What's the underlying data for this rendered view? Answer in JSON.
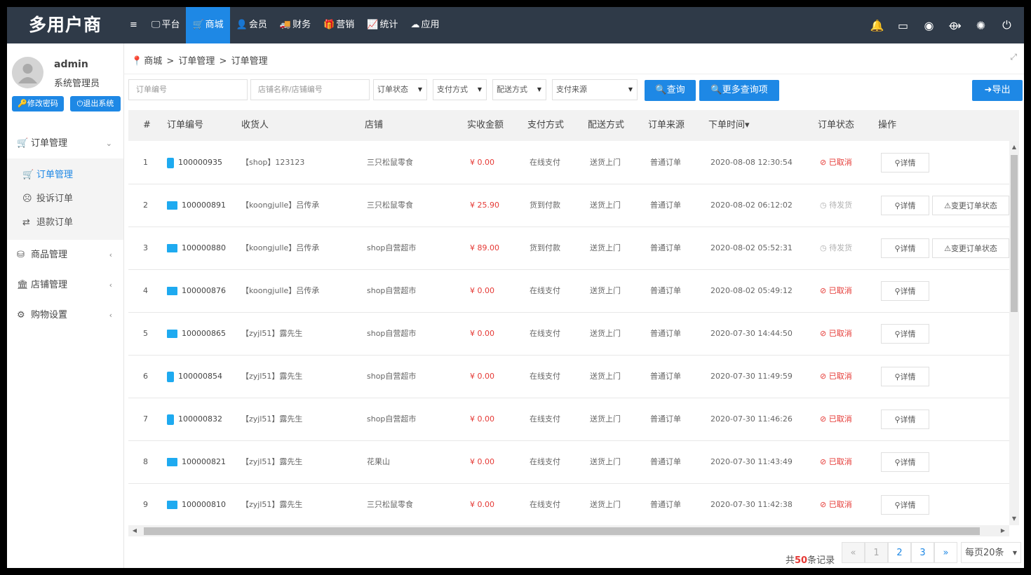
{
  "app": {
    "logo": "多用户商"
  },
  "nav": [
    {
      "icon": "≡",
      "label": "",
      "active": false
    },
    {
      "icon": "🖵",
      "label": "平台",
      "active": false
    },
    {
      "icon": "🛒",
      "label": "商城",
      "active": true
    },
    {
      "icon": "👤",
      "label": "会员",
      "active": false
    },
    {
      "icon": "🚚",
      "label": "财务",
      "active": false
    },
    {
      "icon": "🎁",
      "label": "营销",
      "active": false
    },
    {
      "icon": "📈",
      "label": "统计",
      "active": false
    },
    {
      "icon": "☁",
      "label": "应用",
      "active": false
    }
  ],
  "user": {
    "name": "admin",
    "role": "系统管理员",
    "change_password": "修改密码",
    "logout": "退出系统"
  },
  "menu": {
    "order_management": "订单管理",
    "sub": [
      "订单管理",
      "投诉订单",
      "退款订单"
    ],
    "goods": "商品管理",
    "shops": "店铺管理",
    "shopping": "购物设置"
  },
  "breadcrumb": [
    "商城",
    "订单管理",
    "订单管理"
  ],
  "filters": {
    "order_no_placeholder": "订单编号",
    "shop_placeholder": "店铺名称/店铺编号",
    "order_status": "订单状态",
    "pay_method": "支付方式",
    "delivery": "配送方式",
    "pay_source": "支付来源",
    "search": "查询",
    "more_search": "更多查询项",
    "export": "导出"
  },
  "columns": [
    "#",
    "订单编号",
    "收货人",
    "店铺",
    "实收金额",
    "支付方式",
    "配送方式",
    "订单来源",
    "下单时间",
    "订单状态",
    "操作"
  ],
  "sort_mark": "▾",
  "action_labels": {
    "detail": "详情",
    "change_status": "变更订单状态"
  },
  "rows": [
    {
      "idx": "1",
      "device": "phone",
      "order_no": "100000935",
      "receiver": "【shop】123123",
      "shop": "三只松鼠零食",
      "amount": "¥ 0.00",
      "pay": "在线支付",
      "delivery": "送货上门",
      "source": "普通订单",
      "time": "2020-08-08 12:30:54",
      "status": "已取消",
      "status_type": "cancel",
      "can_change": false
    },
    {
      "idx": "2",
      "device": "pc",
      "order_no": "100000891",
      "receiver": "【koongjulle】吕传承",
      "shop": "三只松鼠零食",
      "amount": "¥ 25.90",
      "pay": "货到付款",
      "delivery": "送货上门",
      "source": "普通订单",
      "time": "2020-08-02 06:12:02",
      "status": "待发货",
      "status_type": "wait",
      "can_change": true
    },
    {
      "idx": "3",
      "device": "pc",
      "order_no": "100000880",
      "receiver": "【koongjulle】吕传承",
      "shop": "shop自营超市",
      "amount": "¥ 89.00",
      "pay": "货到付款",
      "delivery": "送货上门",
      "source": "普通订单",
      "time": "2020-08-02 05:52:31",
      "status": "待发货",
      "status_type": "wait",
      "can_change": true
    },
    {
      "idx": "4",
      "device": "pc",
      "order_no": "100000876",
      "receiver": "【koongjulle】吕传承",
      "shop": "shop自营超市",
      "amount": "¥ 0.00",
      "pay": "在线支付",
      "delivery": "送货上门",
      "source": "普通订单",
      "time": "2020-08-02 05:49:12",
      "status": "已取消",
      "status_type": "cancel",
      "can_change": false
    },
    {
      "idx": "5",
      "device": "pc",
      "order_no": "100000865",
      "receiver": "【zyjl51】露先生",
      "shop": "shop自营超市",
      "amount": "¥ 0.00",
      "pay": "在线支付",
      "delivery": "送货上门",
      "source": "普通订单",
      "time": "2020-07-30 14:44:50",
      "status": "已取消",
      "status_type": "cancel",
      "can_change": false
    },
    {
      "idx": "6",
      "device": "phone",
      "order_no": "100000854",
      "receiver": "【zyjl51】露先生",
      "shop": "shop自营超市",
      "amount": "¥ 0.00",
      "pay": "在线支付",
      "delivery": "送货上门",
      "source": "普通订单",
      "time": "2020-07-30 11:49:59",
      "status": "已取消",
      "status_type": "cancel",
      "can_change": false
    },
    {
      "idx": "7",
      "device": "phone",
      "order_no": "100000832",
      "receiver": "【zyjl51】露先生",
      "shop": "shop自营超市",
      "amount": "¥ 0.00",
      "pay": "在线支付",
      "delivery": "送货上门",
      "source": "普通订单",
      "time": "2020-07-30 11:46:26",
      "status": "已取消",
      "status_type": "cancel",
      "can_change": false
    },
    {
      "idx": "8",
      "device": "pc",
      "order_no": "100000821",
      "receiver": "【zyjl51】露先生",
      "shop": "花果山",
      "amount": "¥ 0.00",
      "pay": "在线支付",
      "delivery": "送货上门",
      "source": "普通订单",
      "time": "2020-07-30 11:43:49",
      "status": "已取消",
      "status_type": "cancel",
      "can_change": false
    },
    {
      "idx": "9",
      "device": "pc",
      "order_no": "100000810",
      "receiver": "【zyjl51】露先生",
      "shop": "三只松鼠零食",
      "amount": "¥ 0.00",
      "pay": "在线支付",
      "delivery": "送货上门",
      "source": "普通订单",
      "time": "2020-07-30 11:42:38",
      "status": "已取消",
      "status_type": "cancel",
      "can_change": false
    }
  ],
  "pagination": {
    "total_prefix": "共",
    "total_count": "50",
    "total_suffix": "条记录",
    "prev": "«",
    "pages": [
      "1",
      "2",
      "3"
    ],
    "next": "»",
    "page_size": "每页20条"
  },
  "colors": {
    "topbar": "#2f3a48",
    "accent": "#1e88e5",
    "danger": "#e53935"
  }
}
